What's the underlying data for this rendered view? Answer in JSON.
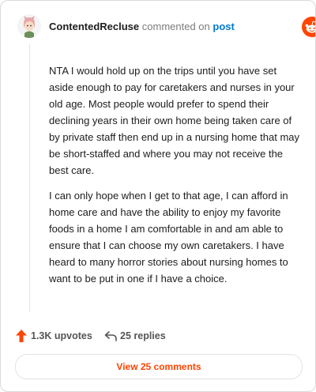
{
  "comment": {
    "author": "ContentedRecluse",
    "action_text": "commented on",
    "target_text": "post",
    "paragraphs": [
      "NTA I would hold up on the trips until you have set aside enough to pay for caretakers and nurses in your old age. Most people would prefer to spend their declining years in their own home being taken care of by private staff then end up in a nursing home that may be short-staffed and where you may not receive the best care.",
      "I can only hope when I get to that age, I can afford in home care and have the ability to enjoy my favorite foods in a home I am comfortable in and am able to ensure that I can choose my own caretakers. I have heard to many horror stories about nursing homes to want to be put in one if I have a choice."
    ]
  },
  "brand": {
    "name": "reddit",
    "icon": "reddit-snoo-icon",
    "color": "#ff4500"
  },
  "stats": {
    "upvotes": "1.3K upvotes",
    "replies": "25 replies",
    "upvote_icon": "upvote-arrow-icon",
    "reply_icon": "reply-arrow-icon",
    "upvote_color": "#ff4500"
  },
  "cta": {
    "label": "View 25 comments"
  }
}
